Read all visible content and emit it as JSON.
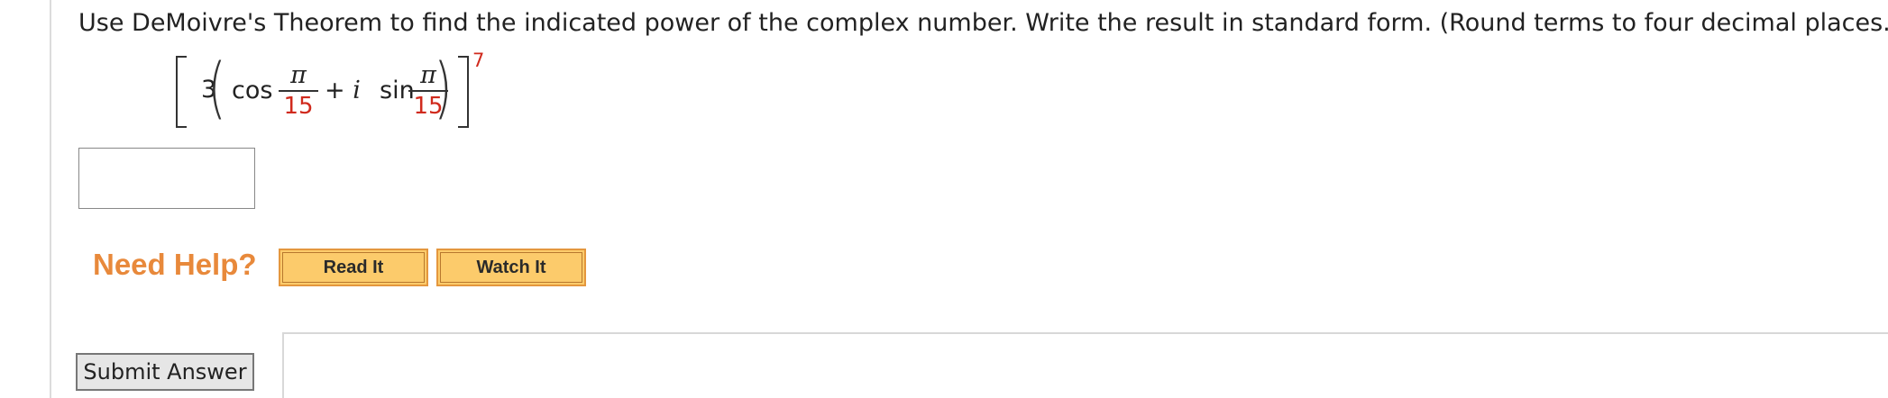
{
  "question": {
    "text": "Use DeMoivre's Theorem to find the indicated power of the complex number. Write the result in standard form. (Round terms to four decimal places.)"
  },
  "expression": {
    "coefficient": "3",
    "cos": "cos",
    "plus": "+",
    "i": "i",
    "sin": "sin",
    "numerator": "π",
    "denominator": "15",
    "exponent": "7"
  },
  "answer": {
    "value": ""
  },
  "help": {
    "label": "Need Help?",
    "read_it": "Read It",
    "watch_it": "Watch It"
  },
  "submit": {
    "label": "Submit Answer"
  },
  "colors": {
    "accent_orange": "#e8893b",
    "button_fill": "#fccb6b",
    "red_text": "#d02a1d"
  }
}
